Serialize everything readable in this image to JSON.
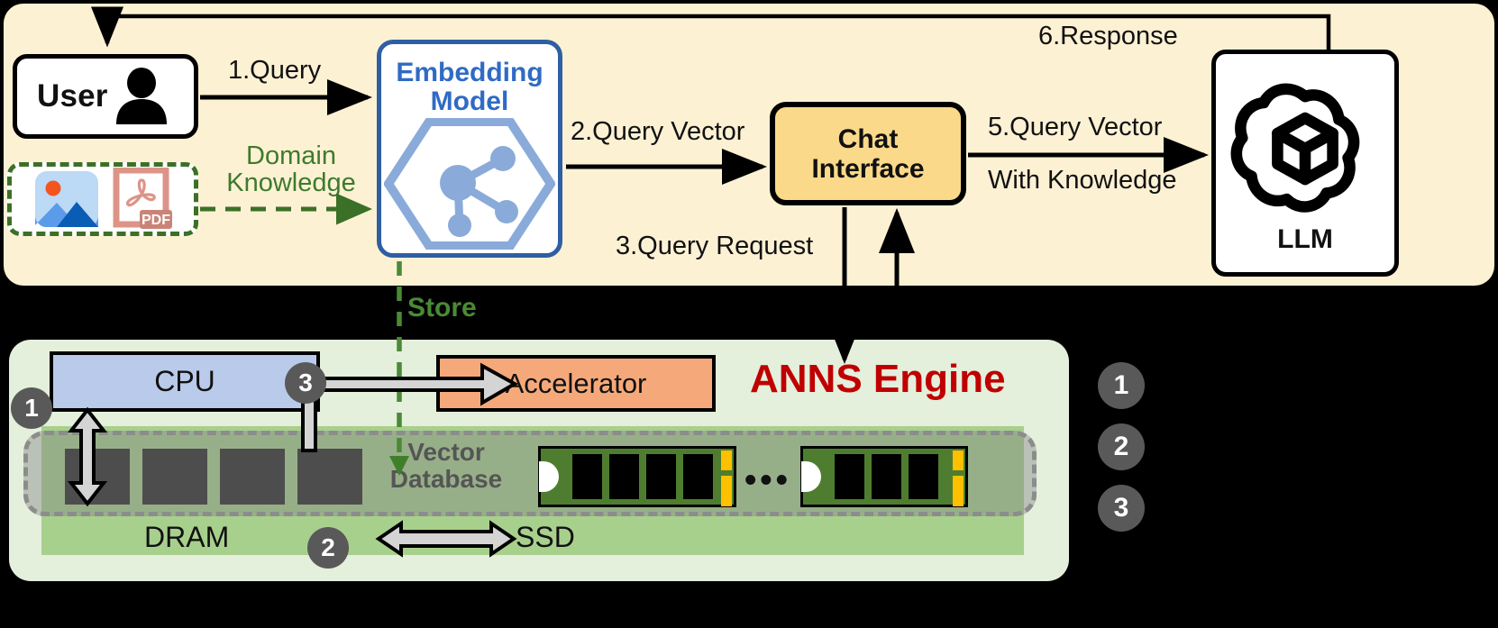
{
  "top_panel": {
    "name": "RAG pipeline panel",
    "bg_color": "#fdf1d4",
    "nodes": {
      "user": {
        "label": "User",
        "icon": "person-icon"
      },
      "domain_knowledge_box": {
        "icons": [
          "image-file-icon",
          "pdf-file-icon"
        ],
        "pdf_badge": "PDF"
      },
      "embedding_model": {
        "label_line1": "Embedding",
        "label_line2": "Model",
        "icon": "hexagon-network-icon",
        "color": "#2f6bc4"
      },
      "chat_interface": {
        "label_line1": "Chat",
        "label_line2": "Interface",
        "bg_color": "#fbd98a"
      },
      "llm": {
        "label": "LLM",
        "icon": "openai-knot-icon"
      }
    },
    "arrow_labels": {
      "query": "1.Query",
      "domain_knowledge_line1": "Domain",
      "domain_knowledge_line2": "Knowledge",
      "query_vector": "2.Query Vector",
      "query_request": "3.Query Request",
      "query_vector_with_knowledge_line1": "5.Query Vector",
      "query_vector_with_knowledge_line2": "With Knowledge",
      "response": "6.Response"
    }
  },
  "store_label": "Store",
  "bottom_panel": {
    "name": "ANNS Engine panel",
    "title": "ANNS Engine",
    "title_color": "#c00000",
    "bg_color": "#e4efdc",
    "cpu": {
      "label": "CPU",
      "bg_color": "#b9caea"
    },
    "accelerator": {
      "label": "Accelerator",
      "bg_color": "#f5a97a"
    },
    "vector_database": {
      "label_line1": "Vector",
      "label_line2": "Database"
    },
    "dram": {
      "label": "DRAM",
      "bg_color": "#a8d08d",
      "chip_count": 4
    },
    "ssd": {
      "label": "SSD",
      "module_count": 2,
      "ellipsis": "•••"
    },
    "markers": {
      "cpu_dram": "1",
      "dram_ssd": "2",
      "cpu_accelerator": "3"
    }
  },
  "legend": {
    "items": [
      "1",
      "2",
      "3"
    ]
  }
}
